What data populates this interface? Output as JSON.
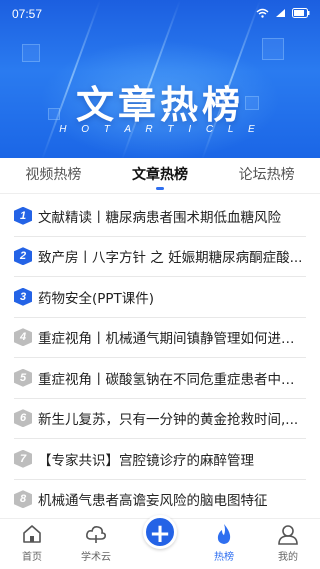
{
  "status_bar": {
    "time": "07:57"
  },
  "hero": {
    "title": "文章热榜",
    "subtitle": "H O T A R T I C L E"
  },
  "tabs": [
    {
      "label": "视频热榜",
      "active": false
    },
    {
      "label": "文章热榜",
      "active": true
    },
    {
      "label": "论坛热榜",
      "active": false
    }
  ],
  "articles": [
    {
      "rank": "1",
      "title": "文献精读丨糖尿病患者围术期低血糖风险"
    },
    {
      "rank": "2",
      "title": "致产房丨八字方针 之 妊娠期糖尿病酮症酸..."
    },
    {
      "rank": "3",
      "title": "药物安全(PPT课件)"
    },
    {
      "rank": "4",
      "title": "重症视角丨机械通气期间镇静管理如何进行..."
    },
    {
      "rank": "5",
      "title": "重症视角丨碳酸氢钠在不同危重症患者中的..."
    },
    {
      "rank": "6",
      "title": "新生儿复苏，只有一分钟的黄金抢救时间,..."
    },
    {
      "rank": "7",
      "title": "【专家共识】宫腔镜诊疗的麻醉管理"
    },
    {
      "rank": "8",
      "title": "机械通气患者高谵妄风险的脑电图特征"
    }
  ],
  "bottom_nav": {
    "home": "首页",
    "academic_cloud": "学术云",
    "hot_list": "热榜",
    "mine": "我的"
  },
  "colors": {
    "accent": "#2f6ff0",
    "rank_top": "#2463e6",
    "rank_rest": "#bdbdbd"
  },
  "icons": {
    "status": [
      "wifi-icon",
      "signal-icon",
      "battery-icon"
    ],
    "nav": [
      "home-icon",
      "cloud-icon",
      "add-icon",
      "flame-icon",
      "user-icon"
    ]
  }
}
